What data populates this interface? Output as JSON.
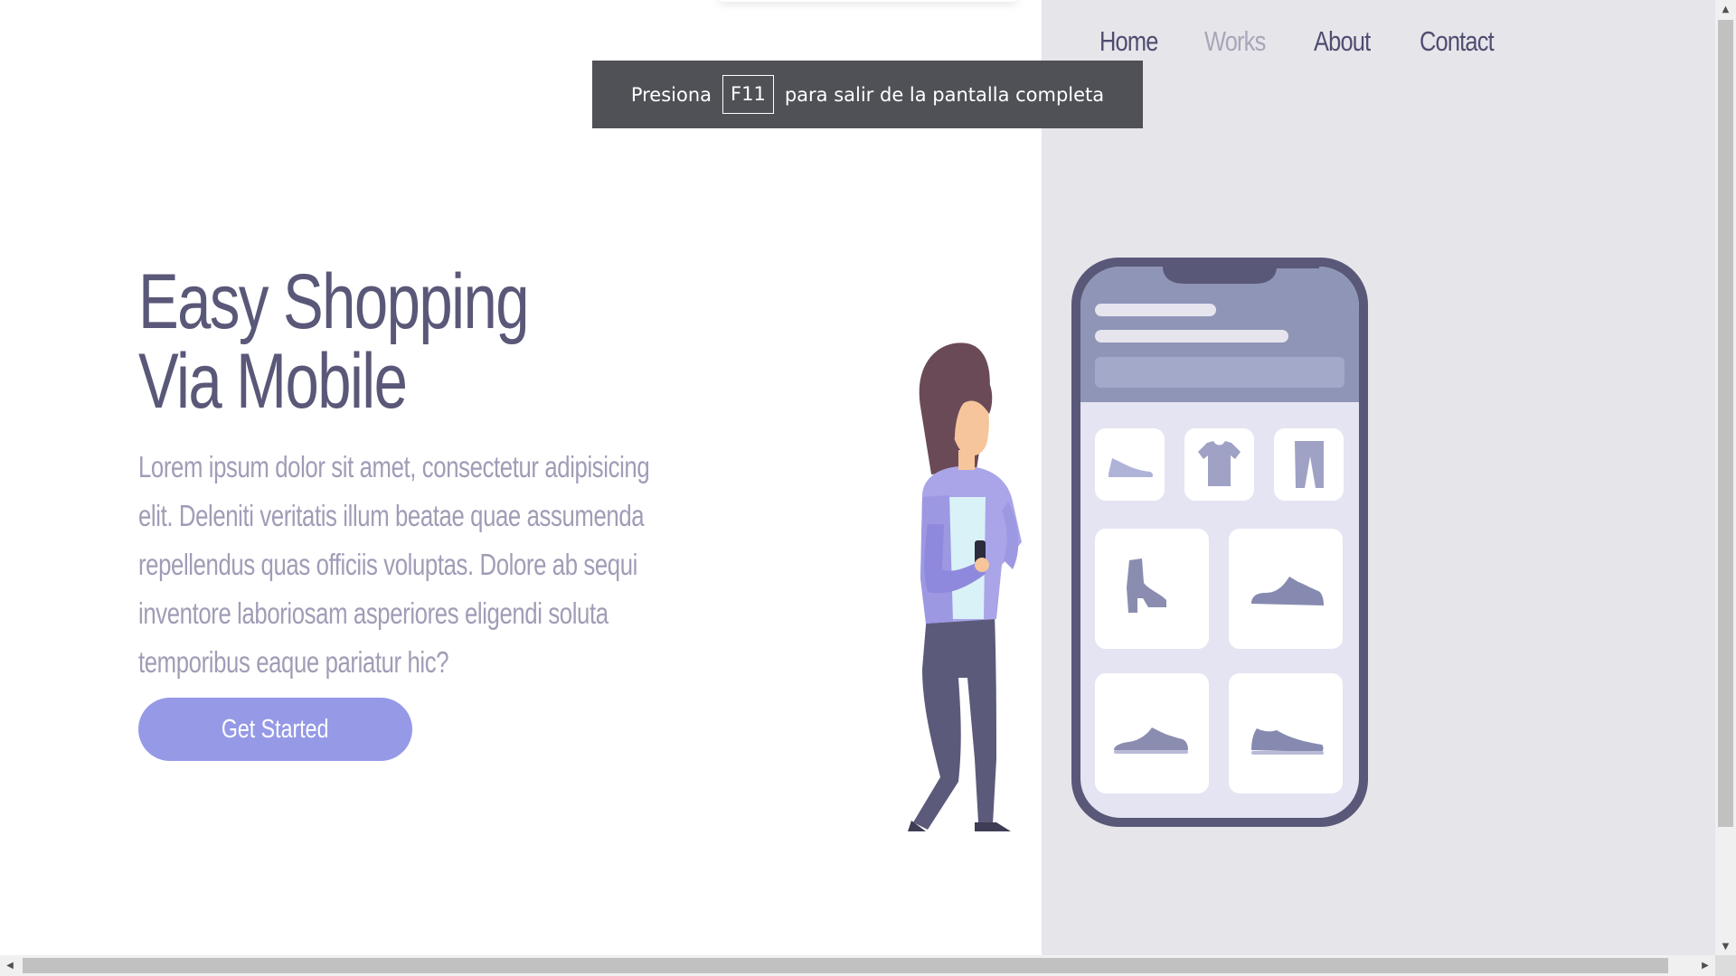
{
  "nav": {
    "items": [
      {
        "label": "Home"
      },
      {
        "label": "Works"
      },
      {
        "label": "About"
      },
      {
        "label": "Contact"
      }
    ]
  },
  "fullscreen_notice": {
    "prefix": "Presiona",
    "key": "F11",
    "suffix": "para salir de la pantalla completa"
  },
  "hero": {
    "title_line1": "Easy Shopping",
    "title_line2": "Via Mobile",
    "description": "Lorem ipsum dolor sit amet, consectetur adipisicing elit. Deleniti veritatis illum beatae quae assumenda repellendus quas officiis voluptas. Dolore ab sequi inventore laboriosam asperiores eligendi soluta temporibus eaque pariatur hic?",
    "cta_label": "Get Started"
  },
  "colors": {
    "title": "#5a5878",
    "description": "#9f9db6",
    "cta": "#9599e6",
    "panel": "#e6e5ea",
    "nav_active": "#4f4d70",
    "nav_muted": "#a8a6b8"
  },
  "icons": {
    "phone_items": [
      "shoe-icon",
      "tshirt-icon",
      "pants-icon",
      "boot-icon",
      "sneaker-icon",
      "sneaker-icon",
      "sneaker-icon"
    ]
  }
}
